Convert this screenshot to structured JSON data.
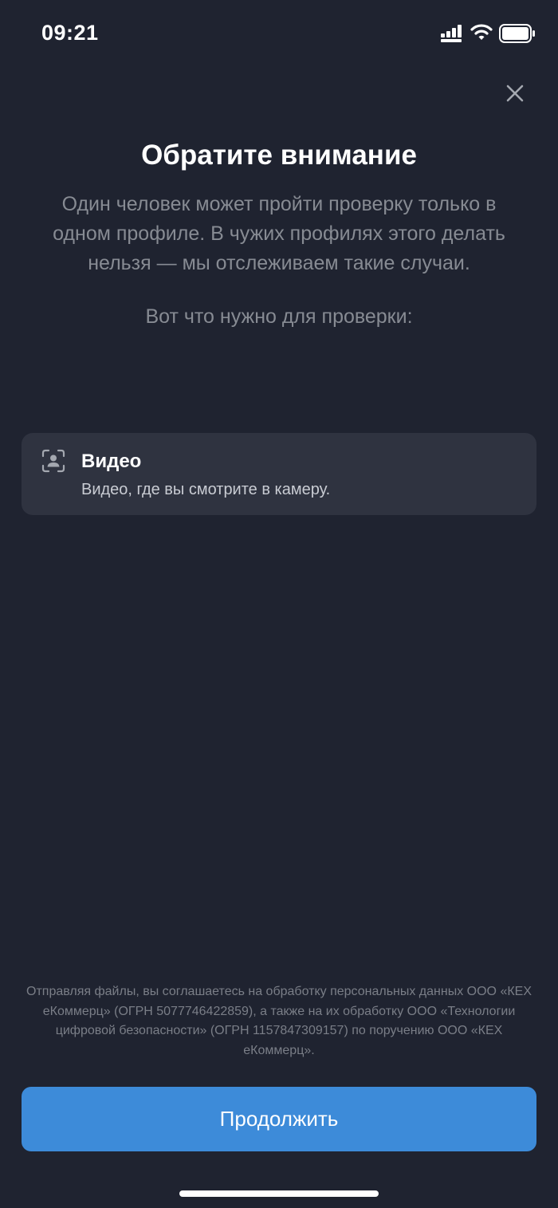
{
  "status_bar": {
    "time": "09:21",
    "icons": [
      "cellular-signal-icon",
      "wifi-icon",
      "battery-icon"
    ]
  },
  "header": {
    "close_icon": "close-icon"
  },
  "main": {
    "title": "Обратите внимание",
    "description": "Один человек может пройти проверку только в одном профиле. В чужих профилях этого делать нельзя — мы отслеживаем такие случаи.",
    "subtitle": "Вот что нужно для проверки:",
    "requirements": [
      {
        "icon": "face-scan-icon",
        "title": "Видео",
        "description": "Видео, где вы смотрите в камеру."
      }
    ]
  },
  "footer": {
    "legal_text": "Отправляя файлы, вы соглашаетесь на обработку персональных данных ООО «КЕХ еКоммерц» (ОГРН 5077746422859), а также на их обработку ООО «Технологии цифровой безопасности» (ОГРН 1157847309157) по поручению ООО «КЕХ еКоммерц».",
    "continue_label": "Продолжить"
  },
  "colors": {
    "background": "#1f2330",
    "card": "#2f3340",
    "accent": "#3d8bd9",
    "muted_text": "#878b93"
  }
}
